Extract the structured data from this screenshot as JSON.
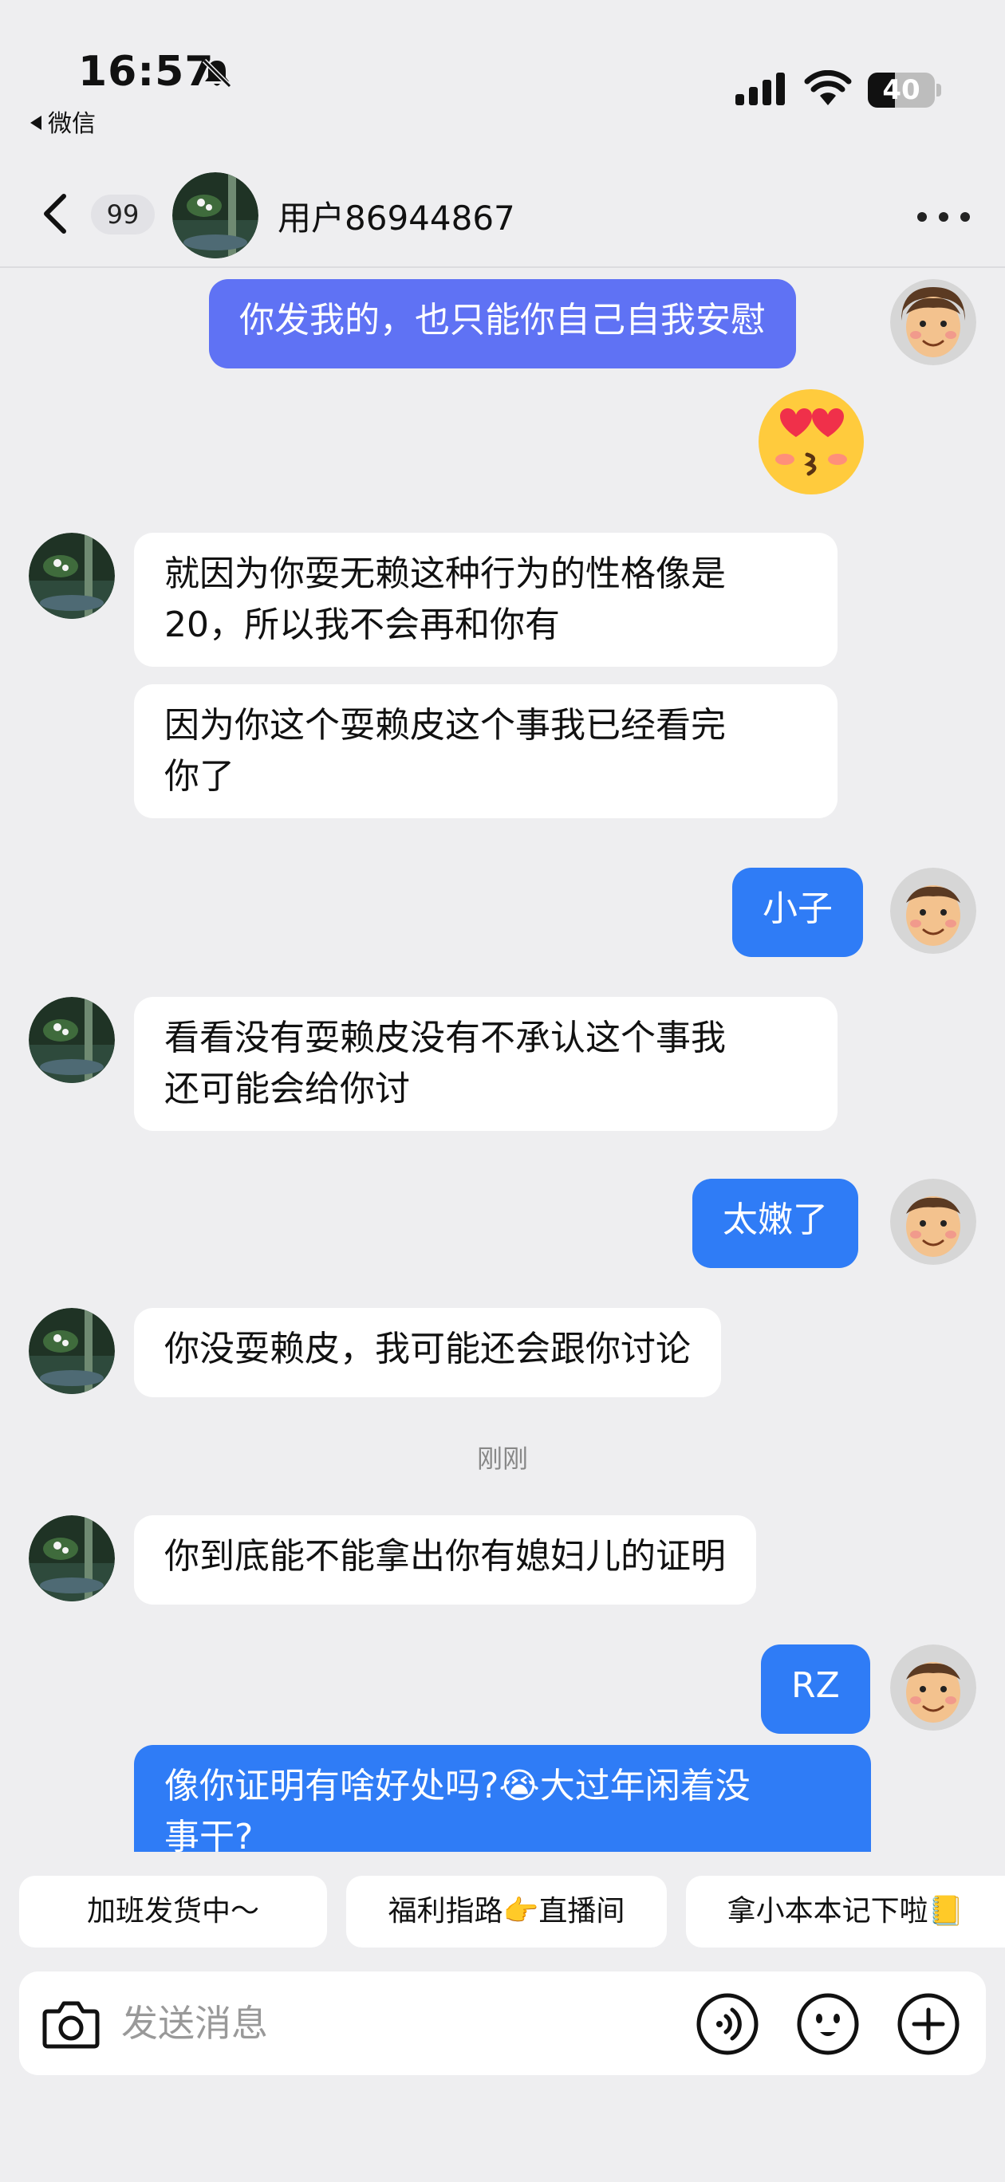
{
  "status_bar": {
    "time": "16:57",
    "back_app": "微信",
    "battery": "40",
    "battery_level": 0.4
  },
  "header": {
    "unread_count": "99",
    "title": "用户86944867"
  },
  "messages": [
    {
      "side": "me",
      "text": "你发我的，也只能你自己自我安慰"
    },
    {
      "side": "me",
      "sticker": "heart-eyes-kiss-emoji"
    },
    {
      "side": "them",
      "lines": [
        "就因为你耍无赖这种行为的性格像是",
        "20，所以我不会再和你有"
      ]
    },
    {
      "side": "them",
      "lines": [
        "因为你这个耍赖皮这个事我已经看完",
        "你了"
      ]
    },
    {
      "side": "me",
      "text": "小子"
    },
    {
      "side": "them",
      "lines": [
        "看看没有耍赖皮没有不承认这个事我",
        "还可能会给你讨"
      ]
    },
    {
      "side": "me",
      "text": "太嫩了"
    },
    {
      "side": "them",
      "text": "你没耍赖皮，我可能还会跟你讨论"
    },
    {
      "side": "them",
      "text": "你到底能不能拿出你有媳妇儿的证明"
    },
    {
      "side": "me",
      "text": "RZ"
    },
    {
      "side": "me",
      "lines": [
        "像你证明有啥好处吗?😭大过年闲着没",
        "事干?"
      ]
    }
  ],
  "timestamp": "刚刚",
  "quick_replies": [
    "加班发货中～",
    "福利指路👉直播间",
    "拿小本本记下啦📒"
  ],
  "input": {
    "placeholder": "发送消息"
  },
  "icons": {
    "camera": "camera-icon",
    "voice": "voice-icon",
    "emoji": "emoji-icon",
    "add": "add-icon",
    "more": "more-icon",
    "back": "back-icon",
    "bell": "bell-off-icon"
  },
  "colors": {
    "my_bubble": "#2f7cf6",
    "my_bubble_first": "#5f72f4",
    "their_bubble": "#ffffff",
    "background": "#eeeef0"
  }
}
